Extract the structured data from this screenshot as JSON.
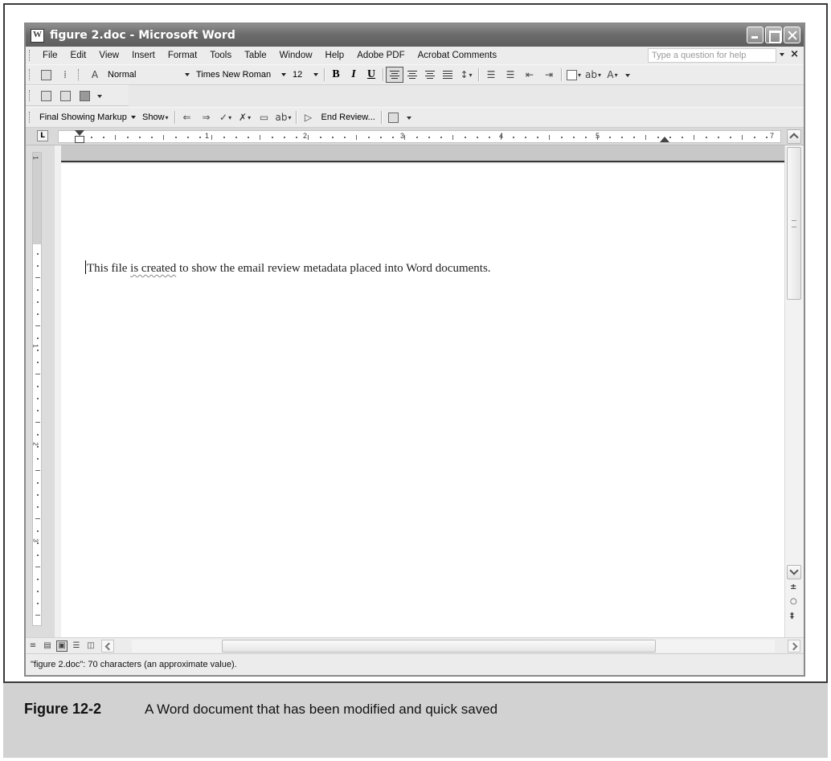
{
  "window": {
    "title": "figure 2.doc - Microsoft Word",
    "title_bar_color": "#6c6c6c"
  },
  "menu": {
    "items": [
      "File",
      "Edit",
      "View",
      "Insert",
      "Format",
      "Tools",
      "Table",
      "Window",
      "Help",
      "Adobe PDF",
      "Acrobat Comments"
    ],
    "help_placeholder": "Type a question for help"
  },
  "formatting_toolbar": {
    "style": "Normal",
    "font": "Times New Roman",
    "size": "12",
    "bold": "B",
    "italic": "I",
    "underline": "U"
  },
  "reviewing_toolbar": {
    "display_mode": "Final Showing Markup",
    "show_label": "Show",
    "end_review_label": "End Review..."
  },
  "ruler": {
    "numbers": [
      "1",
      "2",
      "3",
      "4",
      "5",
      "7"
    ],
    "vertical_numbers": [
      "1",
      "1",
      "2",
      "3"
    ]
  },
  "document": {
    "text_before": "This file ",
    "text_squiggle": "is created",
    "text_after": " to show the email review metadata placed into Word documents."
  },
  "status": {
    "text": "\"figure 2.doc\": 70 characters (an approximate value)."
  },
  "caption": {
    "label": "Figure 12-2",
    "text": "A Word document that has been modified and quick saved"
  }
}
